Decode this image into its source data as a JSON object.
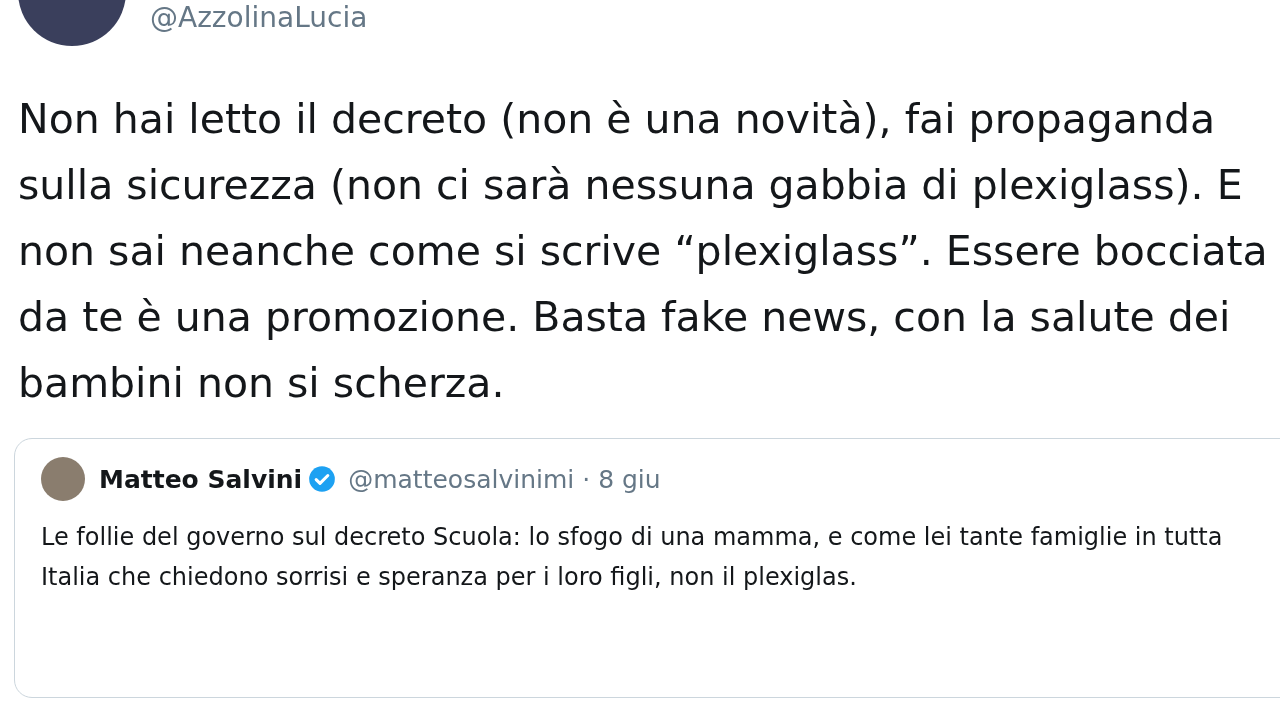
{
  "author": {
    "handle": "@AzzolinaLucia"
  },
  "tweet_text": "Non hai letto il decreto (non è una novità), fai propaganda sulla sicurezza (non ci sarà nessuna gabbia di plexiglass). E non sai neanche come si scrive “plexiglass”. Essere bocciata da te è una promozione. Basta fake news, con la salute dei bambini non si scherza.",
  "quoted_tweet": {
    "name": "Matteo Salvini",
    "verified": true,
    "handle": "@matteosalvinimi",
    "date": "· 8 giu",
    "text": "Le follie del governo sul decreto Scuola: lo sfogo di una mamma, e come lei tante famiglie in tutta Italia che chiedono sorrisi e speranza per i loro figli, non il plexiglas."
  }
}
